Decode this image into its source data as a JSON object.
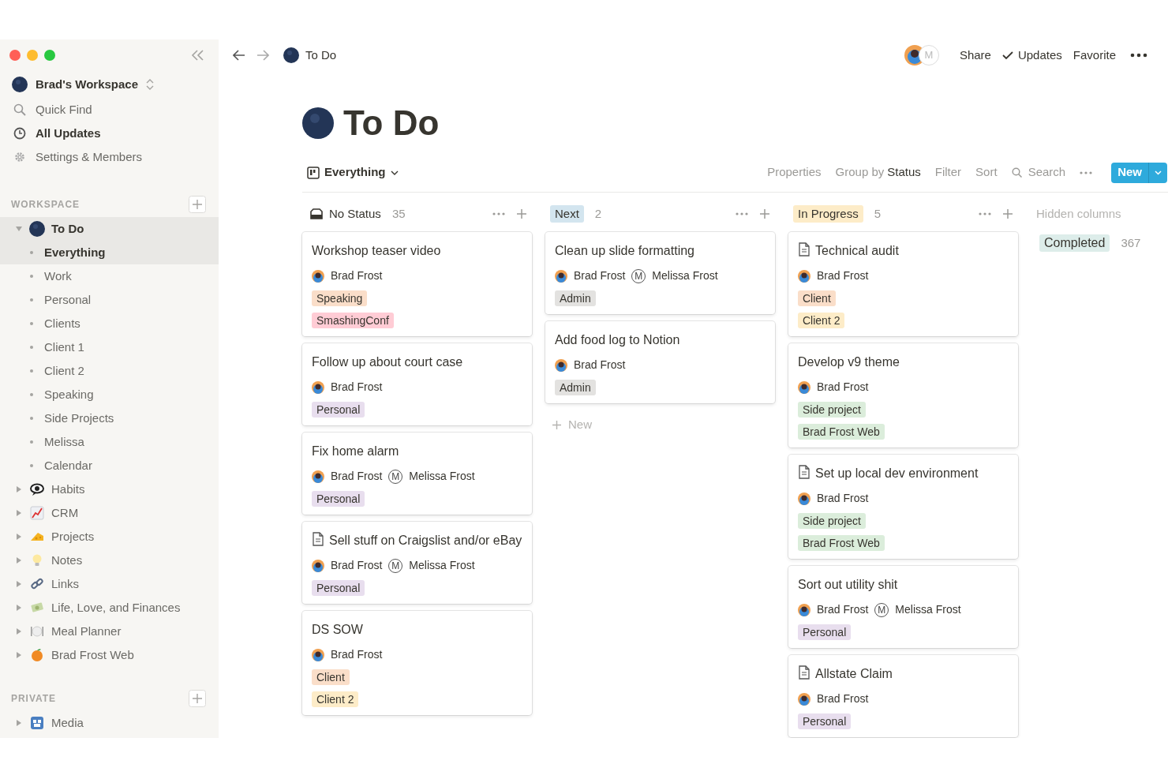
{
  "sidebar": {
    "workspace": "Brad's Workspace",
    "nav": [
      {
        "label": "Quick Find",
        "selected": false
      },
      {
        "label": "All Updates",
        "selected": true
      },
      {
        "label": "Settings & Members",
        "selected": false
      }
    ],
    "sections": [
      {
        "title": "WORKSPACE",
        "items": [
          {
            "label": "To Do",
            "selected": true,
            "expanded": true,
            "children": [
              {
                "label": "Everything",
                "selected": true
              },
              {
                "label": "Work",
                "selected": false
              },
              {
                "label": "Personal",
                "selected": false
              },
              {
                "label": "Clients",
                "selected": false
              },
              {
                "label": "Client 1",
                "selected": false
              },
              {
                "label": "Client 2",
                "selected": false
              },
              {
                "label": "Speaking",
                "selected": false
              },
              {
                "label": "Side Projects",
                "selected": false
              },
              {
                "label": "Melissa",
                "selected": false
              },
              {
                "label": "Calendar",
                "selected": false
              }
            ]
          },
          {
            "label": "Habits",
            "selected": false,
            "expanded": false
          },
          {
            "label": "CRM",
            "selected": false,
            "expanded": false
          },
          {
            "label": "Projects",
            "selected": false,
            "expanded": false
          },
          {
            "label": "Notes",
            "selected": false,
            "expanded": false
          },
          {
            "label": "Links",
            "selected": false,
            "expanded": false
          },
          {
            "label": "Life, Love, and Finances",
            "selected": false,
            "expanded": false
          },
          {
            "label": "Meal Planner",
            "selected": false,
            "expanded": false
          },
          {
            "label": "Brad Frost Web",
            "selected": false,
            "expanded": false
          }
        ]
      },
      {
        "title": "PRIVATE",
        "items": [
          {
            "label": "Media",
            "selected": false,
            "expanded": false
          }
        ]
      }
    ]
  },
  "topbar": {
    "breadcrumb": "To Do",
    "avatar_initial": "M",
    "actions": [
      "Share",
      "Updates",
      "Favorite"
    ]
  },
  "page": {
    "title": "To Do",
    "view": "Everything",
    "toolbar": {
      "properties": "Properties",
      "group_by": "Group by",
      "group_value": "Status",
      "filter": "Filter",
      "sort": "Sort",
      "search": "Search",
      "new": "New"
    },
    "columns": [
      {
        "label": "No Status",
        "count": "35",
        "color": "#ffffff",
        "cards": [
          {
            "title": "Workshop teaser video",
            "page_icon": false,
            "people": [
              {
                "name": "Brad Frost"
              }
            ],
            "tags": [
              {
                "label": "Speaking",
                "color": "#fadec9"
              },
              {
                "label": "SmashingConf",
                "color": "#ffccd5"
              }
            ]
          },
          {
            "title": "Follow up about court case",
            "page_icon": false,
            "people": [
              {
                "name": "Brad Frost"
              }
            ],
            "tags": [
              {
                "label": "Personal",
                "color": "#e8deee"
              }
            ]
          },
          {
            "title": "Fix home alarm",
            "page_icon": false,
            "people": [
              {
                "name": "Brad Frost"
              },
              {
                "name": "Melissa Frost",
                "initial": "M"
              }
            ],
            "tags": [
              {
                "label": "Personal",
                "color": "#e8deee"
              }
            ]
          },
          {
            "title": "Sell stuff on Craigslist and/or eBay",
            "page_icon": true,
            "people": [
              {
                "name": "Brad Frost"
              },
              {
                "name": "Melissa Frost",
                "initial": "M"
              }
            ],
            "tags": [
              {
                "label": "Personal",
                "color": "#e8deee"
              }
            ]
          },
          {
            "title": "DS SOW",
            "page_icon": false,
            "people": [
              {
                "name": "Brad Frost"
              }
            ],
            "tags": [
              {
                "label": "Client",
                "color": "#fadec9"
              },
              {
                "label": "Client 2",
                "color": "#fdecc8"
              }
            ]
          }
        ]
      },
      {
        "label": "Next",
        "count": "2",
        "color": "#d3e5ef",
        "new": "New",
        "cards": [
          {
            "title": "Clean up slide formatting",
            "page_icon": false,
            "people": [
              {
                "name": "Brad Frost"
              },
              {
                "name": "Melissa Frost",
                "initial": "M"
              }
            ],
            "tags": [
              {
                "label": "Admin",
                "color": "#e3e2e0"
              }
            ]
          },
          {
            "title": "Add food log to Notion",
            "page_icon": false,
            "people": [
              {
                "name": "Brad Frost"
              }
            ],
            "tags": [
              {
                "label": "Admin",
                "color": "#e3e2e0"
              }
            ]
          }
        ]
      },
      {
        "label": "In Progress",
        "count": "5",
        "color": "#fdecc8",
        "cards": [
          {
            "title": "Technical audit",
            "page_icon": true,
            "people": [
              {
                "name": "Brad Frost"
              }
            ],
            "tags": [
              {
                "label": "Client",
                "color": "#fadec9"
              },
              {
                "label": "Client 2",
                "color": "#fdecc8"
              }
            ]
          },
          {
            "title": "Develop v9 theme",
            "page_icon": false,
            "people": [
              {
                "name": "Brad Frost"
              }
            ],
            "tags": [
              {
                "label": "Side project",
                "color": "#dbeddb"
              },
              {
                "label": "Brad Frost Web",
                "color": "#dbeddb"
              }
            ]
          },
          {
            "title": "Set up local dev environment",
            "page_icon": true,
            "people": [
              {
                "name": "Brad Frost"
              }
            ],
            "tags": [
              {
                "label": "Side project",
                "color": "#dbeddb"
              },
              {
                "label": "Brad Frost Web",
                "color": "#dbeddb"
              }
            ]
          },
          {
            "title": "Sort out utility shit",
            "page_icon": false,
            "people": [
              {
                "name": "Brad Frost"
              },
              {
                "name": "Melissa Frost",
                "initial": "M"
              }
            ],
            "tags": [
              {
                "label": "Personal",
                "color": "#e8deee"
              }
            ]
          },
          {
            "title": "Allstate Claim",
            "page_icon": true,
            "people": [
              {
                "name": "Brad Frost"
              }
            ],
            "tags": [
              {
                "label": "Personal",
                "color": "#e8deee"
              }
            ]
          }
        ]
      }
    ],
    "hidden": {
      "title": "Hidden columns",
      "groups": [
        {
          "label": "Completed",
          "count": "367",
          "color": "#ddedea"
        }
      ]
    }
  }
}
